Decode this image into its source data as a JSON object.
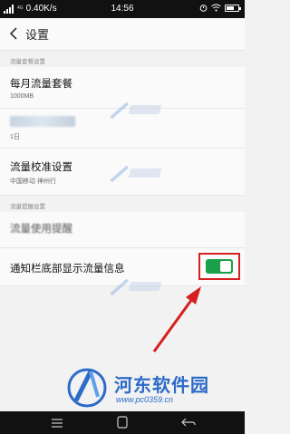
{
  "status": {
    "signal_label": "4G",
    "net_speed": "0.40K/s",
    "time": "14:56"
  },
  "header": {
    "title": "设置"
  },
  "sections": {
    "plan_settings": "流量套餐设置",
    "alert_settings": "流量提醒设置"
  },
  "rows": {
    "monthly_plan": {
      "title": "每月流量套餐",
      "value": "1000MB"
    },
    "blurred_date": {
      "value": "1日"
    },
    "calibration": {
      "title": "流量校准设置",
      "value": "中国移动 神州行"
    },
    "partial": {
      "title": "流量使用提醒"
    },
    "notification": {
      "title": "通知栏底部显示流量信息",
      "toggle_on": true
    }
  },
  "watermark": {
    "name": "河东软件园",
    "url": "www.pc0359.cn"
  },
  "colors": {
    "accent_green": "#1aa04b",
    "highlight_red": "#d52020",
    "logo_blue": "#2c6bc8"
  }
}
